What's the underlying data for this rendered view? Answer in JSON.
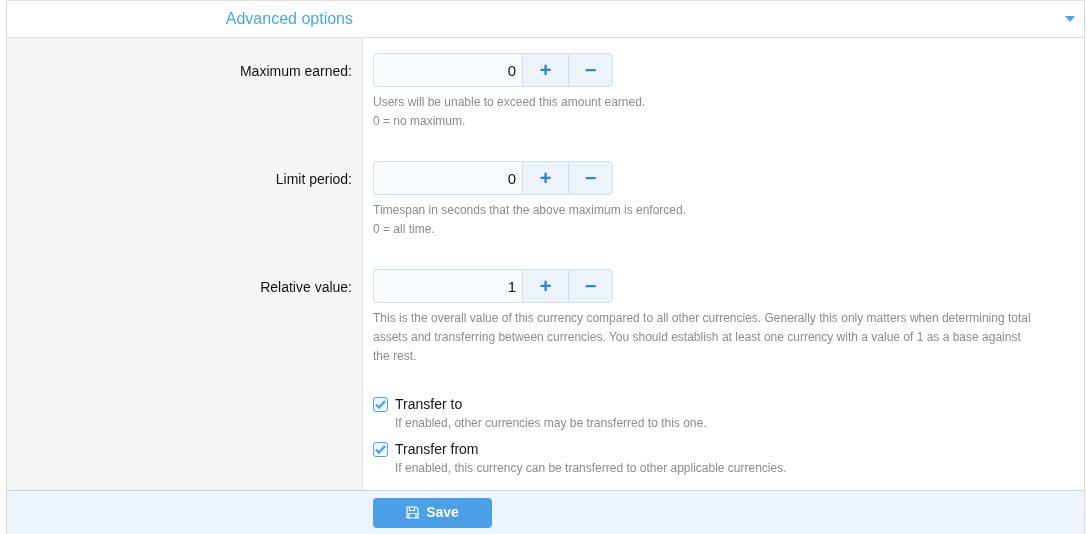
{
  "section": {
    "title": "Advanced options",
    "expanded": true
  },
  "rows": [
    {
      "kind": "number",
      "label": "Maximum earned:",
      "value": "0",
      "plus": "+",
      "minus": "−",
      "hint": [
        "Users will be unable to exceed this amount earned.",
        "0 = no maximum."
      ]
    },
    {
      "kind": "number",
      "label": "Limit period:",
      "value": "0",
      "plus": "+",
      "minus": "−",
      "hint": [
        "Timespan in seconds that the above maximum is enforced.",
        "0 = all time."
      ]
    },
    {
      "kind": "number",
      "label": "Relative value:",
      "value": "1",
      "plus": "+",
      "minus": "−",
      "hint": [
        "This is the overall value of this currency compared to all other currencies. Generally this only matters when determining total assets and transferring between currencies. You should establish at least one currency with a value of 1 as a base against the rest."
      ]
    },
    {
      "kind": "checkboxes",
      "options": [
        {
          "label": "Transfer to",
          "checked": true,
          "hint": "If enabled, other currencies may be transferred to this one."
        },
        {
          "label": "Transfer from",
          "checked": true,
          "hint": "If enabled, this currency can be transferred to other applicable currencies."
        }
      ]
    }
  ],
  "save_button": "Save"
}
